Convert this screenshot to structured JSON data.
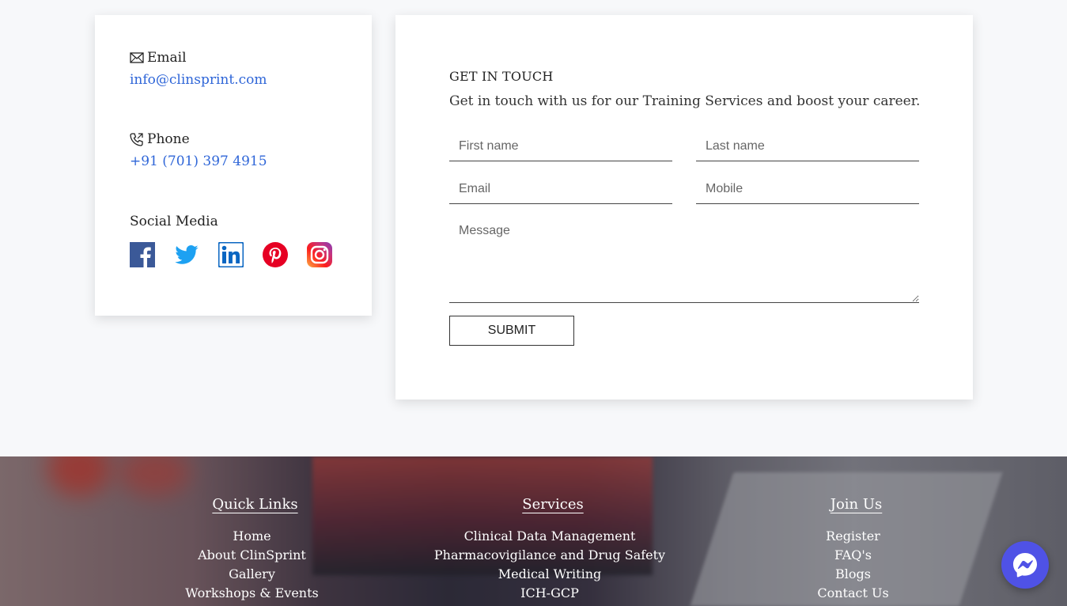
{
  "contact": {
    "email_heading": "Email",
    "email_value": "info@clinsprint.com",
    "phone_heading": "Phone",
    "phone_value": "+91 (701) 397 4915",
    "social_heading": "Social Media",
    "social_icons": [
      "facebook-icon",
      "twitter-icon",
      "linkedin-icon",
      "pinterest-icon",
      "instagram-icon"
    ]
  },
  "form": {
    "title": "GET IN TOUCH",
    "subtitle": "Get in touch with us for our Training Services and boost your career.",
    "first_name_placeholder": "First name",
    "last_name_placeholder": "Last name",
    "email_placeholder": "Email",
    "mobile_placeholder": "Mobile",
    "message_placeholder": "Message",
    "submit_label": "SUBMIT"
  },
  "footer": {
    "quick_links": {
      "heading": "Quick Links",
      "items": [
        "Home",
        "About ClinSprint",
        "Gallery",
        "Workshops & Events"
      ]
    },
    "services": {
      "heading": "Services",
      "items": [
        "Clinical Data Management",
        "Pharmacovigilance and Drug Safety",
        "Medical Writing",
        "ICH-GCP"
      ]
    },
    "join_us": {
      "heading": "Join Us",
      "items": [
        "Register",
        "FAQ's",
        "Blogs",
        "Contact Us"
      ]
    }
  },
  "colors": {
    "link_blue": "#2f66d8",
    "facebook": "#3b5998",
    "twitter": "#1da1f2",
    "linkedin": "#0a66c2",
    "pinterest": "#e60023",
    "messenger": "#4f52e6"
  }
}
